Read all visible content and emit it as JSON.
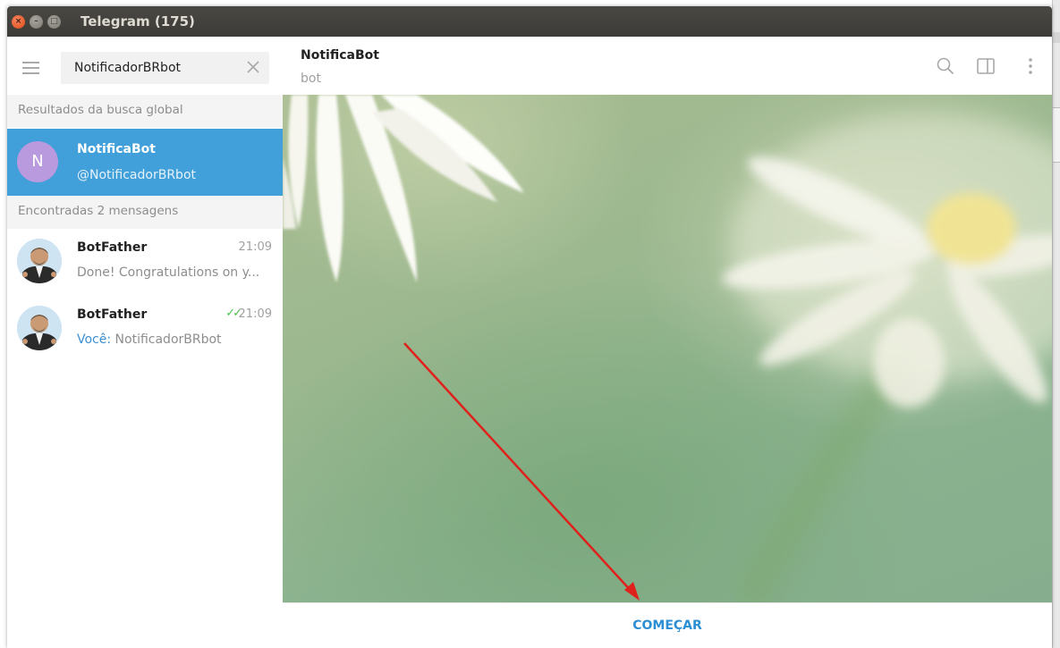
{
  "window": {
    "title": "Telegram (175)"
  },
  "sidebar": {
    "search": {
      "value": "NotificadorBRbot"
    },
    "sections": [
      {
        "label": "Resultados da busca global"
      },
      {
        "label": "Encontradas 2 mensagens"
      }
    ],
    "peer": {
      "avatar_letter": "N",
      "name": "NotificaBot",
      "username": "@NotificadorBRbot"
    },
    "messages": [
      {
        "name": "BotFather",
        "time": "21:09",
        "text": "Done! Congratulations on y..."
      },
      {
        "name": "BotFather",
        "time": "21:09",
        "you_label": "Você:",
        "text": " NotificadorBRbot"
      }
    ]
  },
  "chat": {
    "title": "NotificaBot",
    "status": "bot",
    "start_label": "COMEÇAR"
  },
  "colors": {
    "accent": "#419fd9",
    "start_button": "#2c8ed4",
    "annotation_arrow": "#e0201b"
  }
}
